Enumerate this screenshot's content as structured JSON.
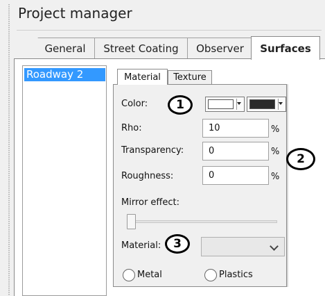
{
  "window": {
    "title": "Project manager"
  },
  "tabs": [
    {
      "label": "General",
      "active": false
    },
    {
      "label": "Street Coating",
      "active": false
    },
    {
      "label": "Observer",
      "active": false
    },
    {
      "label": "Surfaces",
      "active": true
    }
  ],
  "surfaces_list": {
    "items": [
      {
        "label": "Roadway 2",
        "selected": true
      }
    ]
  },
  "inner_tabs": [
    {
      "label": "Material",
      "active": true
    },
    {
      "label": "Texture",
      "active": false
    }
  ],
  "material": {
    "color_label": "Color:",
    "color_primary": "#ffffff",
    "color_secondary": "#2a2a2a",
    "rho_label": "Rho:",
    "rho_value": "10",
    "rho_unit": "%",
    "transparency_label": "Transparency:",
    "transparency_value": "0",
    "transparency_unit": "%",
    "roughness_label": "Roughness:",
    "roughness_value": "0",
    "roughness_unit": "%",
    "mirror_label": "Mirror effect:",
    "mirror_value": 0,
    "material_label": "Material:",
    "material_selected": "",
    "radio_metal": "Metal",
    "radio_plastics": "Plastics"
  },
  "callouts": [
    "1",
    "2",
    "3"
  ],
  "colors": {
    "selection": "#3399ff",
    "panel": "#f0f0f0"
  }
}
